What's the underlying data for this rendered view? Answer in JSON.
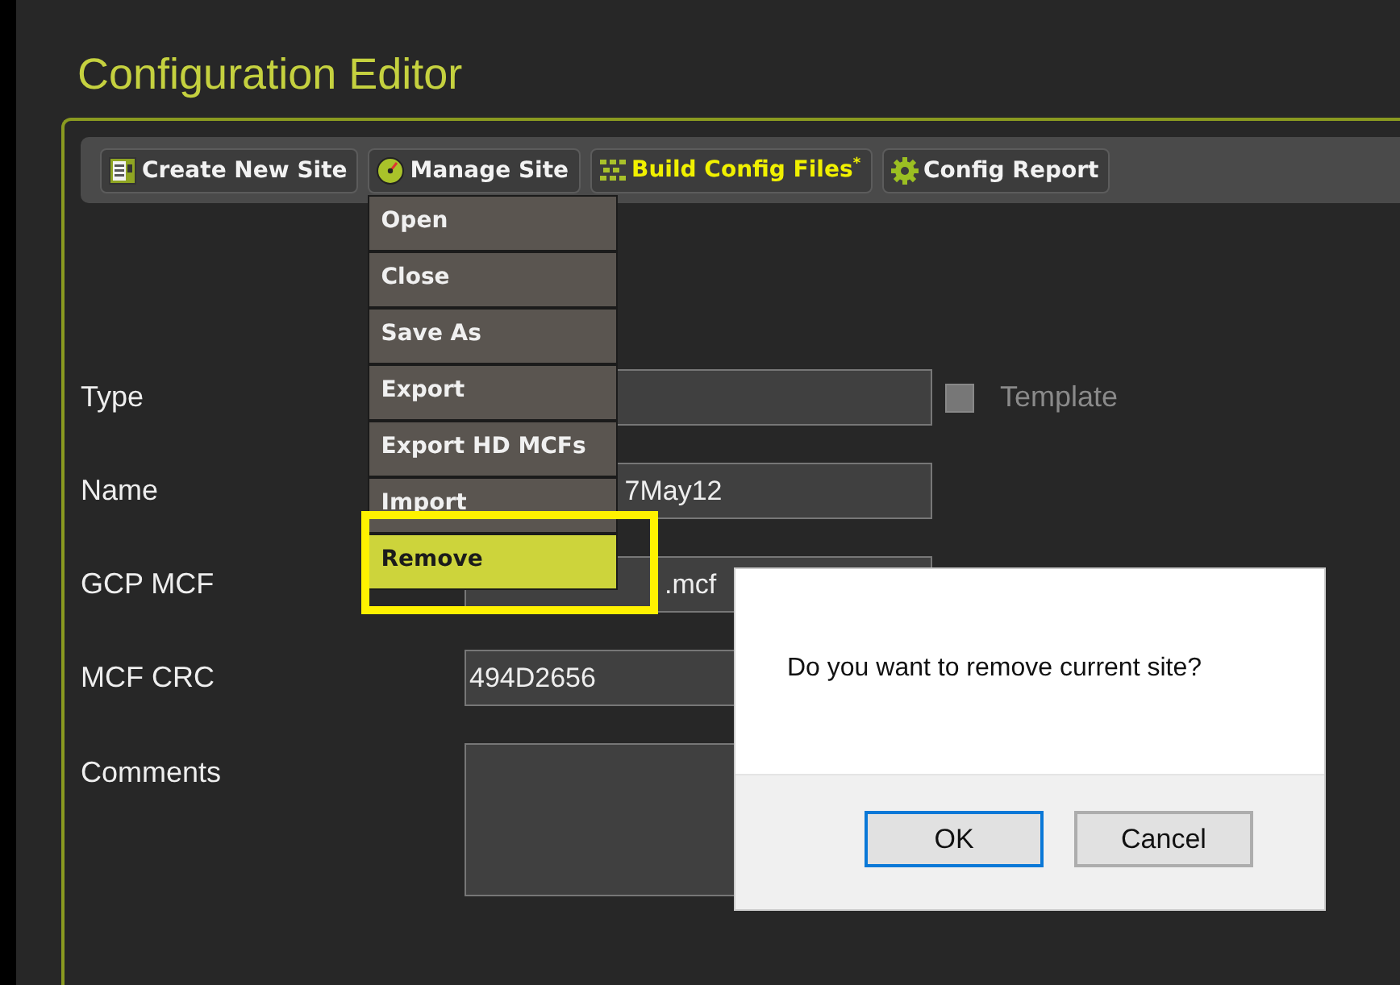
{
  "title": "Configuration Editor",
  "toolbar": [
    {
      "label": "Create New Site",
      "kind": "document",
      "emphasized": false
    },
    {
      "label": "Manage Site",
      "kind": "gauge",
      "emphasized": false
    },
    {
      "label": "Build Config Files$^{*}$",
      "kind": "grid",
      "emphasized": true
    },
    {
      "label": "Config Report",
      "kind": "gear",
      "emphasized": false
    }
  ],
  "menu": {
    "items": [
      {
        "label": "Open",
        "selected": false
      },
      {
        "label": "Close",
        "selected": false
      },
      {
        "label": "Save As",
        "selected": false
      },
      {
        "label": "Export",
        "selected": false
      },
      {
        "label": "Export HD MCFs",
        "selected": false
      },
      {
        "label": "Import",
        "selected": false
      },
      {
        "label": "Remove",
        "selected": true
      }
    ]
  },
  "form": {
    "fields": [
      {
        "label": "Type",
        "kind": "text",
        "option": {
          "label": "Template",
          "checked": false
        }
      },
      {
        "label": "Name",
        "kind": "text",
        "value": "7May12"
      },
      {
        "label": "GCP MCF",
        "kind": "text",
        "value": ".mcf"
      },
      {
        "label": "MCF CRC",
        "kind": "text",
        "value": "494D2656"
      },
      {
        "label": "Comments",
        "kind": "area"
      }
    ]
  },
  "dialog": {
    "message": "Do you want to remove current site?",
    "buttons": [
      {
        "label": "OK",
        "focused": true
      },
      {
        "label": "Cancel",
        "focused": false
      }
    ]
  }
}
